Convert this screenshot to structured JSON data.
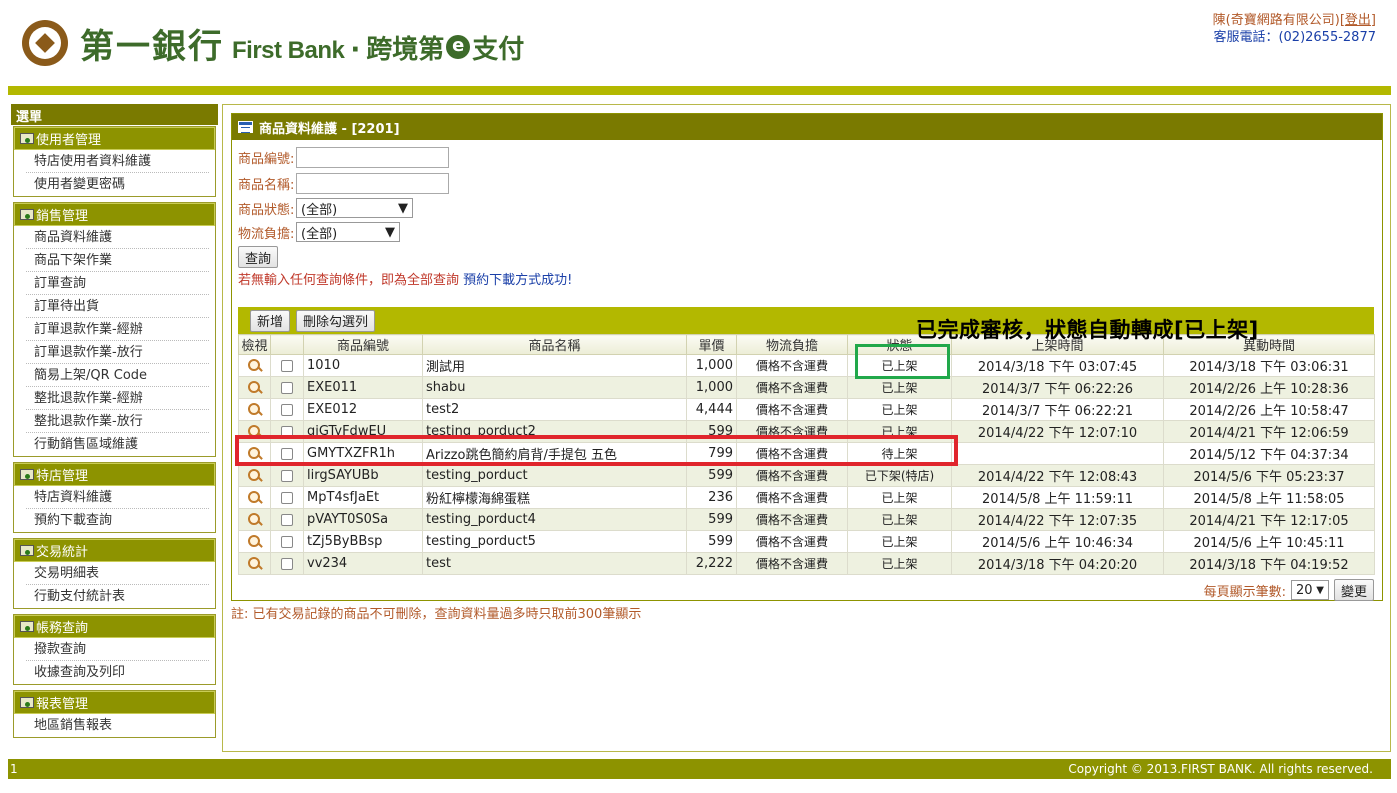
{
  "header": {
    "logo_zh": "第一銀行",
    "logo_en": "First Bank",
    "logo_dot": "·",
    "logo_sub_1": "跨境第",
    "logo_e": "e",
    "logo_sub_2": "支付",
    "user_name": "陳(奇寶網路有限公司)",
    "logout_label": "登出",
    "service_phone": "客服電話：(02)2655-2877"
  },
  "sidebar": {
    "title": "選單",
    "groups": [
      {
        "label": "使用者管理",
        "items": [
          "特店使用者資料維護",
          "使用者變更密碼"
        ]
      },
      {
        "label": "銷售管理",
        "items": [
          "商品資料維護",
          "商品下架作業",
          "訂單查詢",
          "訂單待出貨",
          "訂單退款作業-經辦",
          "訂單退款作業-放行",
          "簡易上架/QR Code",
          "整批退款作業-經辦",
          "整批退款作業-放行",
          "行動銷售區域維護"
        ]
      },
      {
        "label": "特店管理",
        "items": [
          "特店資料維護",
          "預約下載查詢"
        ]
      },
      {
        "label": "交易統計",
        "items": [
          "交易明細表",
          "行動支付統計表"
        ]
      },
      {
        "label": "帳務查詢",
        "items": [
          "撥款查詢",
          "收據查詢及列印"
        ]
      },
      {
        "label": "報表管理",
        "items": [
          "地區銷售報表"
        ]
      }
    ]
  },
  "panel": {
    "title": "商品資料維護 - [2201]",
    "form": {
      "product_no_label": "商品編號:",
      "product_name_label": "商品名稱:",
      "product_status_label": "商品狀態:",
      "product_status_value": "(全部)",
      "shipping_label": "物流負擔:",
      "shipping_value": "(全部)",
      "query_button": "查詢"
    },
    "hint_red": "若無輸入任何查詢條件，即為全部查詢",
    "hint_blue": "預約下載方式成功!",
    "toolbar": {
      "add_button": "新增",
      "delete_button": "刪除勾選列"
    },
    "columns": [
      "檢視",
      "",
      "商品編號",
      "商品名稱",
      "單價",
      "物流負擔",
      "狀態",
      "上架時間",
      "異動時間"
    ],
    "rows": [
      {
        "code": "1010",
        "name": "測試用",
        "price": "1,000",
        "shipping": "價格不含運費",
        "status": "已上架",
        "listed": "2014/3/18 下午 03:07:45",
        "modified": "2014/3/18 下午 03:06:31"
      },
      {
        "code": "EXE011",
        "name": "shabu",
        "price": "1,000",
        "shipping": "價格不含運費",
        "status": "已上架",
        "listed": "2014/3/7 下午 06:22:26",
        "modified": "2014/2/26 上午 10:28:36"
      },
      {
        "code": "EXE012",
        "name": "test2",
        "price": "4,444",
        "shipping": "價格不含運費",
        "status": "已上架",
        "listed": "2014/3/7 下午 06:22:21",
        "modified": "2014/2/26 上午 10:58:47"
      },
      {
        "code": "giGTyFdwEU",
        "name": "testing_porduct2",
        "price": "599",
        "shipping": "價格不含運費",
        "status": "已上架",
        "listed": "2014/4/22 下午 12:07:10",
        "modified": "2014/4/21 下午 12:06:59"
      },
      {
        "code": "GMYTXZFR1h",
        "name": "Arizzo跳色簡約肩背/手提包 五色",
        "price": "799",
        "shipping": "價格不含運費",
        "status": "待上架",
        "listed": "",
        "modified": "2014/5/12 下午 04:37:34"
      },
      {
        "code": "lirgSAYUBb",
        "name": "testing_porduct",
        "price": "599",
        "shipping": "價格不含運費",
        "status": "已下架(特店)",
        "listed": "2014/4/22 下午 12:08:43",
        "modified": "2014/5/6 下午 05:23:37"
      },
      {
        "code": "MpT4sfJaEt",
        "name": "粉紅檸檬海綿蛋糕",
        "price": "236",
        "shipping": "價格不含運費",
        "status": "已上架",
        "listed": "2014/5/8 上午 11:59:11",
        "modified": "2014/5/8 上午 11:58:05"
      },
      {
        "code": "pVAYT0S0Sa",
        "name": "testing_porduct4",
        "price": "599",
        "shipping": "價格不含運費",
        "status": "已上架",
        "listed": "2014/4/22 下午 12:07:35",
        "modified": "2014/4/21 下午 12:17:05"
      },
      {
        "code": "tZj5ByBBsp",
        "name": "testing_porduct5",
        "price": "599",
        "shipping": "價格不含運費",
        "status": "已上架",
        "listed": "2014/5/6 上午 10:46:34",
        "modified": "2014/5/6 上午 10:45:11"
      },
      {
        "code": "vv234",
        "name": "test",
        "price": "2,222",
        "shipping": "價格不含運費",
        "status": "已上架",
        "listed": "2014/3/18 下午 04:20:20",
        "modified": "2014/3/18 下午 04:19:52"
      }
    ],
    "pager": {
      "label": "每頁顯示筆數:",
      "value": "20",
      "change_button": "變更"
    }
  },
  "note": "註: 已有交易記錄的商品不可刪除，查詢資料量過多時只取前300筆顯示",
  "annotation": {
    "text": "已完成審核，狀態自動轉成[已上架]",
    "green_color": "#21a84a",
    "red_color": "#e0252c"
  },
  "footer": {
    "left": "1",
    "copyright": "Copyright © 2013.FIRST BANK. All rights reserved."
  }
}
